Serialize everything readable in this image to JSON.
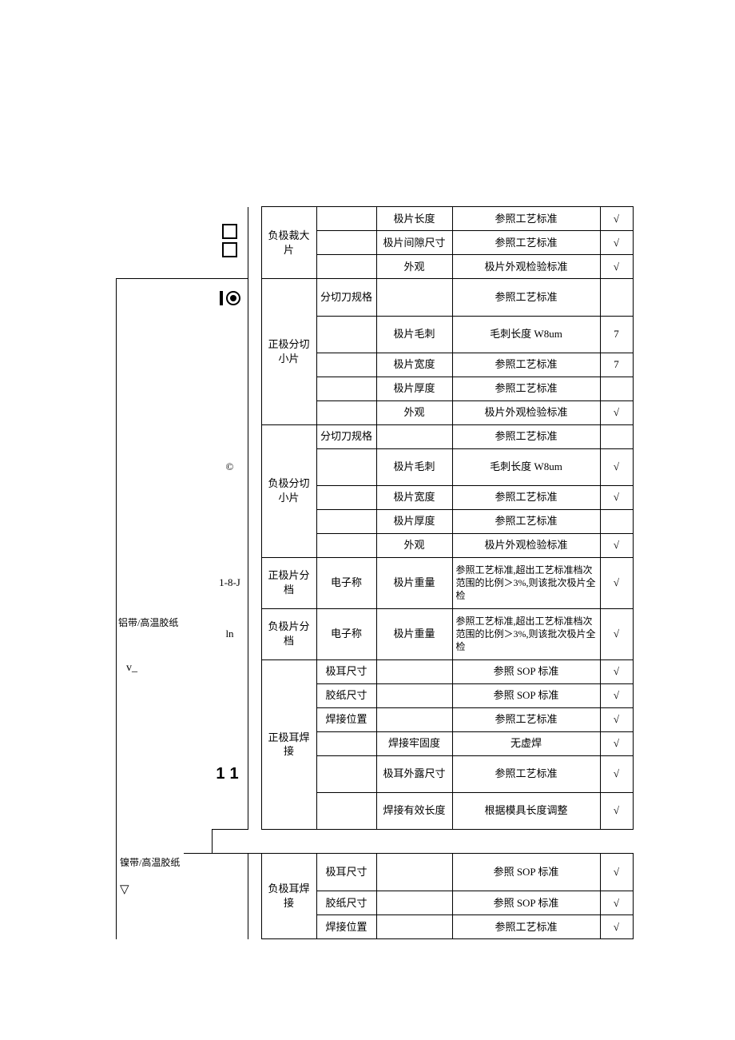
{
  "left": {
    "copyright": "©",
    "code": "1-8-J",
    "ln": "ln",
    "al_tape": "铝带/高温胶纸",
    "v_under": "v_",
    "ni_tape": "镍带/高温胶纸",
    "tri": "▽"
  },
  "steps": {
    "neg_big": "负极裁大片",
    "pos_small": "正极分切小片",
    "neg_small": "负极分切小片",
    "pos_sort": "正极片分档",
    "neg_sort": "负极片分档",
    "pos_tab": "正极耳焊接",
    "neg_tab": "负极耳焊接"
  },
  "instr": {
    "cutter": "分切刀规格",
    "scale": "电子称",
    "tab_dim": "极耳尺寸",
    "tape_dim": "胶纸尺寸",
    "weld_pos": "焊接位置"
  },
  "items": {
    "len": "极片长度",
    "gap": "极片间隙尺寸",
    "appearance": "外观",
    "burr": "极片毛刺",
    "width": "极片宽度",
    "thick": "极片厚度",
    "weight": "极片重量",
    "strength": "焊接牢固度",
    "expose": "极耳外露尺寸",
    "eff_len": "焊接有效长度"
  },
  "specs": {
    "process": "参照工艺标准",
    "appearance": "极片外观检验标准",
    "burr": "毛刺长度 W8um",
    "sop": "参照 SOP 标准",
    "no_cold": "无虚焊",
    "mold": "根据模具长度调整",
    "weight": "参照工艺标准,超出工艺标准档次范围的比例＞3%,则该批次极片全检"
  },
  "marks": {
    "check": "√",
    "seven": "7"
  }
}
